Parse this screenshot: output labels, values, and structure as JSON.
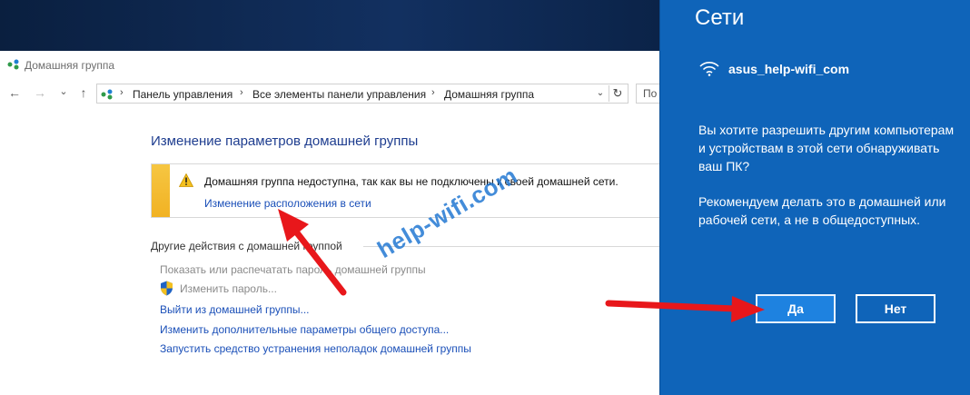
{
  "window": {
    "title": "Домашняя группа"
  },
  "nav": {
    "back": "←",
    "forward": "→",
    "recent": "⌄",
    "up": "↑",
    "breadcrumbs": [
      "Панель управления",
      "Все элементы панели управления",
      "Домашняя группа"
    ],
    "separator": "›",
    "dropdown": "⌄",
    "refresh": "↻",
    "search_placeholder": "По"
  },
  "main": {
    "page_title": "Изменение параметров домашней группы",
    "notice": {
      "text": "Домашняя группа недоступна, так как вы не подключены к своей домашней сети.",
      "link": "Изменение расположения в сети"
    },
    "other_actions": {
      "title": "Другие действия с домашней группой",
      "items": [
        {
          "label": "Показать или распечатать пароль домашней группы",
          "enabled": false
        },
        {
          "label": "Изменить пароль...",
          "enabled": false
        },
        {
          "label": "Выйти из домашней группы...",
          "enabled": true
        },
        {
          "label": "Изменить дополнительные параметры общего доступа...",
          "enabled": true
        },
        {
          "label": "Запустить средство устранения неполадок домашней группы",
          "enabled": true
        }
      ]
    }
  },
  "networks_panel": {
    "title": "Сети",
    "network_name": "asus_help-wifi_com",
    "question": "Вы хотите разрешить другим компьютерам и устройствам в этой сети обнаруживать ваш ПК?",
    "recommendation": "Рекомендуем делать это в домашней или рабочей сети, а не в общедоступных.",
    "yes_label": "Да",
    "no_label": "Нет"
  },
  "watermark": {
    "text": "help-wifi.com"
  },
  "colors": {
    "panel_bg": "#0f64b9",
    "yes_button": "#1e82e0",
    "link": "#1a4fb8",
    "title": "#1e3d8f",
    "notice_bar": "#f1b223",
    "arrow": "#e8171b"
  }
}
